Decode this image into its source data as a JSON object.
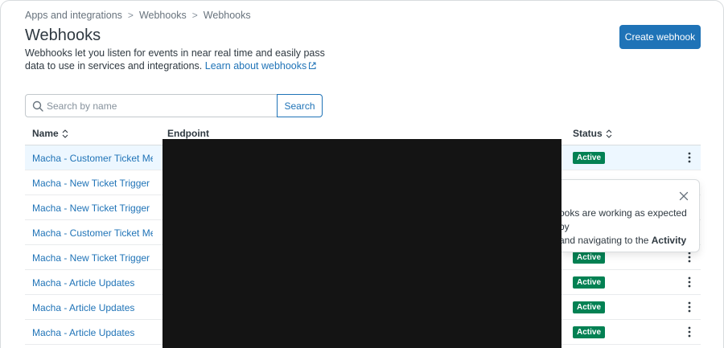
{
  "breadcrumb": {
    "items": [
      "Apps and integrations",
      "Webhooks",
      "Webhooks"
    ],
    "separator": ">"
  },
  "page": {
    "title": "Webhooks",
    "description": "Webhooks let you listen for events in near real time and easily pass data to use in services and integrations.",
    "learn_link": "Learn about webhooks"
  },
  "toolbar": {
    "create_label": "Create webhook",
    "search_placeholder": "Search by name",
    "search_label": "Search"
  },
  "table": {
    "columns": {
      "name": "Name",
      "endpoint": "Endpoint",
      "status": "Status"
    },
    "rows": [
      {
        "name": "Macha - Customer Ticket Me...",
        "status": "Active"
      },
      {
        "name": "Macha - New Ticket Trigger",
        "status": ""
      },
      {
        "name": "Macha - New Ticket Trigger",
        "status": ""
      },
      {
        "name": "Macha - Customer Ticket Me...",
        "status": ""
      },
      {
        "name": "Macha - New Ticket Trigger",
        "status": "Active"
      },
      {
        "name": "Macha - Article Updates",
        "status": "Active"
      },
      {
        "name": "Macha - Article Updates",
        "status": "Active"
      },
      {
        "name": "Macha - Article Updates",
        "status": "Active"
      }
    ]
  },
  "popover": {
    "line1": "ooks are working as expected by",
    "line2_prefix": "and navigating to the ",
    "line2_bold": "Activity"
  },
  "colors": {
    "accent": "#1f73b7",
    "active_badge": "#038153",
    "redaction": "#141414"
  }
}
